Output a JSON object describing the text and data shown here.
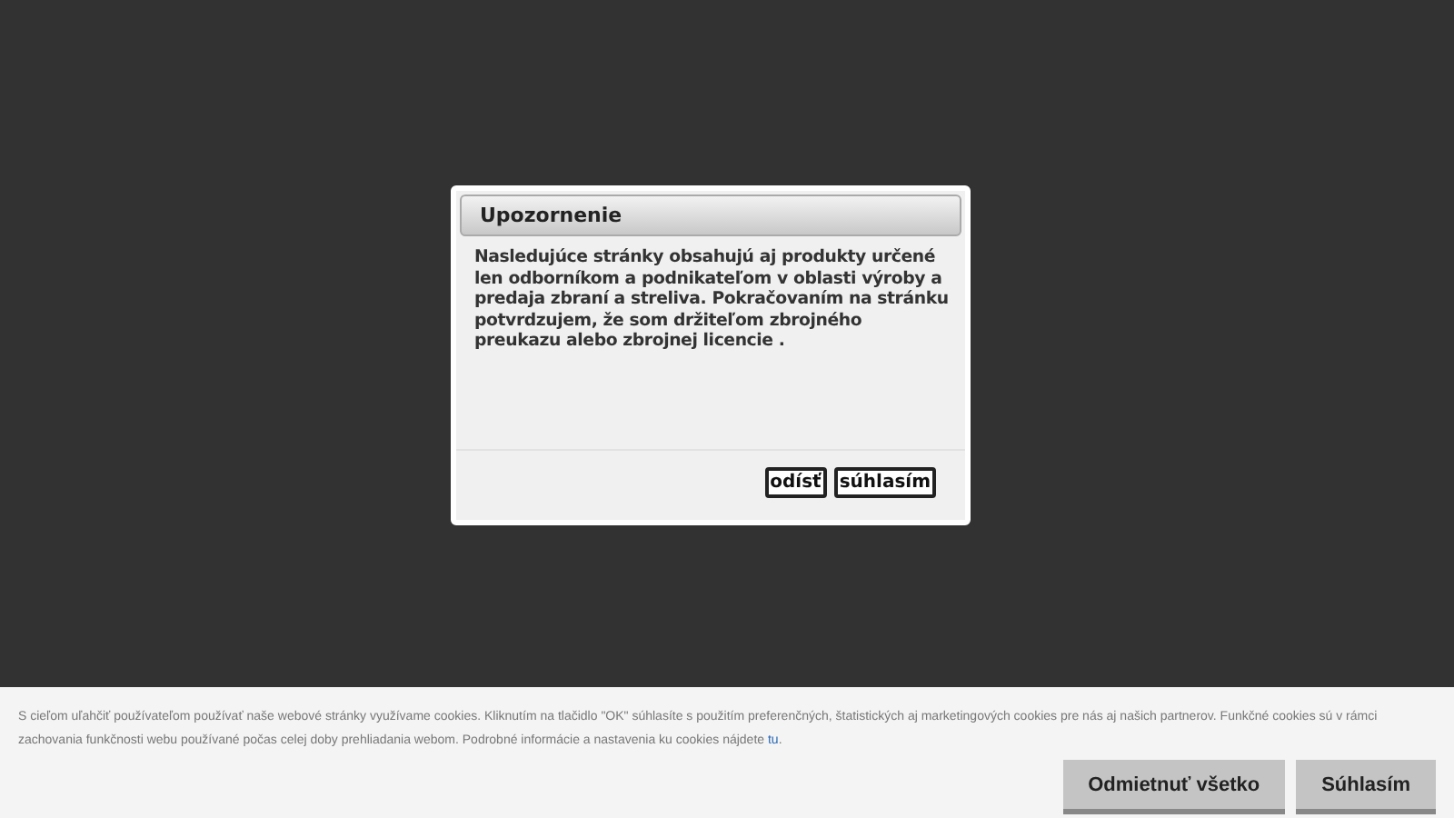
{
  "dialog": {
    "title": "Upozornenie",
    "message": "Nasledujúce stránky obsahujú aj produkty určené len odborníkom a podnikateľom v oblasti výroby a predaja zbraní a streliva. Pokračovaním na stránku potvrdzujem, že som držiteľom zbrojného preukazu alebo zbrojnej licencie .",
    "buttons": [
      "odísť",
      "súhlasím"
    ]
  },
  "cookie_bar": {
    "text": "S cieľom uľahčiť používateľom používať naše webové stránky využívame cookies. Kliknutím na tlačidlo \"OK\" súhlasíte s použitím preferenčných, štatistických aj marketingových cookies pre nás aj našich partnerov. Funkčné cookies sú v rámci zachovania funkčnosti webu používané počas celej doby prehliadania webom. Podrobné informácie a nastavenia ku cookies nájdete",
    "link": "tu",
    "link_suffix": ".",
    "buttons": [
      "Odmietnuť všetko",
      "Súhlasím"
    ]
  }
}
